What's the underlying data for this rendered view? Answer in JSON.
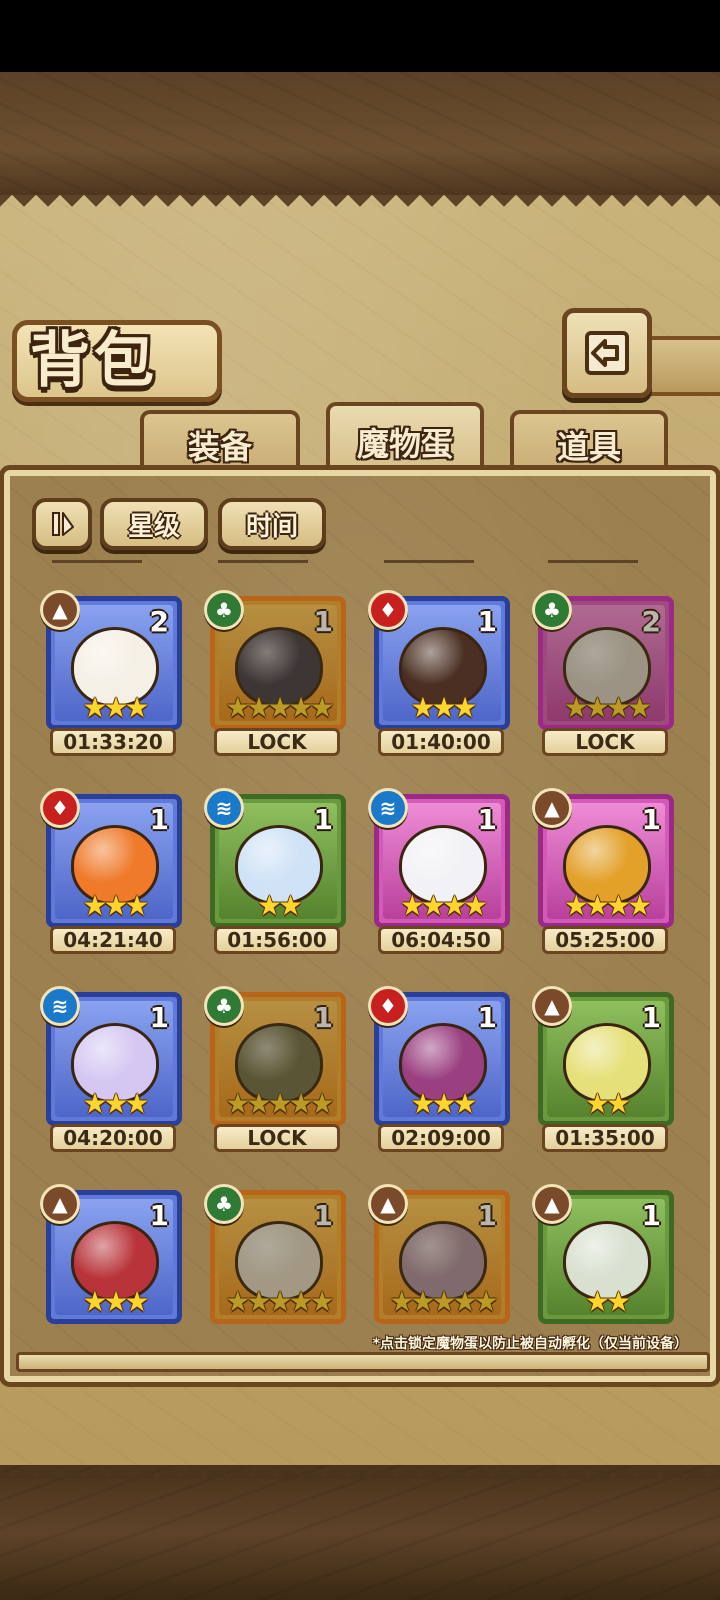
{
  "header": {
    "title": "背包"
  },
  "tabs": [
    {
      "label": "装备",
      "active": false
    },
    {
      "label": "魔物蛋",
      "active": true
    },
    {
      "label": "道具",
      "active": false
    }
  ],
  "filters": {
    "sort_icon": "sort-toggle-icon",
    "star_label": "星级",
    "time_label": "时间"
  },
  "eggs": [
    {
      "element": "earth",
      "frame": "blue",
      "count": "2",
      "stars": "★★★",
      "status": "01:33:20",
      "locked": false
    },
    {
      "element": "nature",
      "frame": "gold",
      "count": "1",
      "stars": "★★★★★",
      "status": "LOCK",
      "locked": true
    },
    {
      "element": "fire",
      "frame": "blue",
      "count": "1",
      "stars": "★★★",
      "status": "01:40:00",
      "locked": false
    },
    {
      "element": "nature",
      "frame": "pink",
      "count": "2",
      "stars": "★★★★",
      "status": "LOCK",
      "locked": true
    },
    {
      "element": "fire",
      "frame": "blue",
      "count": "1",
      "stars": "★★★",
      "status": "04:21:40",
      "locked": false
    },
    {
      "element": "water",
      "frame": "green",
      "count": "1",
      "stars": "★★",
      "status": "01:56:00",
      "locked": false
    },
    {
      "element": "water",
      "frame": "pink",
      "count": "1",
      "stars": "★★★★",
      "status": "06:04:50",
      "locked": false
    },
    {
      "element": "earth",
      "frame": "pink",
      "count": "1",
      "stars": "★★★★",
      "status": "05:25:00",
      "locked": false
    },
    {
      "element": "water",
      "frame": "blue",
      "count": "1",
      "stars": "★★★",
      "status": "04:20:00",
      "locked": false
    },
    {
      "element": "nature",
      "frame": "gold",
      "count": "1",
      "stars": "★★★★★",
      "status": "LOCK",
      "locked": true
    },
    {
      "element": "fire",
      "frame": "blue",
      "count": "1",
      "stars": "★★★",
      "status": "02:09:00",
      "locked": false
    },
    {
      "element": "earth",
      "frame": "green",
      "count": "1",
      "stars": "★★",
      "status": "01:35:00",
      "locked": false
    },
    {
      "element": "earth",
      "frame": "blue",
      "count": "1",
      "stars": "★★★",
      "status": "",
      "locked": false
    },
    {
      "element": "nature",
      "frame": "gold",
      "count": "1",
      "stars": "★★★★★",
      "status": "",
      "locked": true
    },
    {
      "element": "earth",
      "frame": "gold",
      "count": "1",
      "stars": "★★★★★",
      "status": "",
      "locked": true
    },
    {
      "element": "earth",
      "frame": "green",
      "count": "1",
      "stars": "★★",
      "status": "",
      "locked": false
    }
  ],
  "footer_note": "*点击锁定魔物蛋以防止被自动孵化（仅当前设备）",
  "colors": {
    "earth": "#7a4a2a",
    "nature": "#2f7a34",
    "fire": "#c81f1f",
    "water": "#1b79c9",
    "frame_blue": "#2b3f9a",
    "frame_gold": "#b8651a",
    "frame_pink": "#9b2a86",
    "frame_green": "#3f6a24"
  }
}
